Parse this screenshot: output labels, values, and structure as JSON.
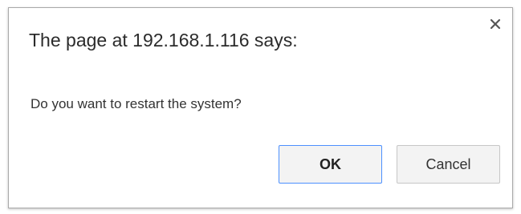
{
  "dialog": {
    "title": "The page at 192.168.1.116 says:",
    "message": "Do you want to restart the system?",
    "ok_label": "OK",
    "cancel_label": "Cancel",
    "close_icon": "close-icon"
  },
  "colors": {
    "ok_border": "#4d90fe",
    "button_bg": "#f3f3f3",
    "dialog_border": "#a9a9a9"
  }
}
